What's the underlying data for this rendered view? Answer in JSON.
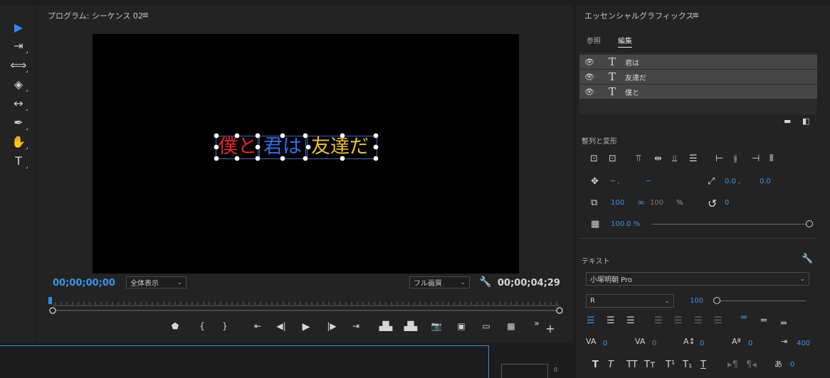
{
  "program": {
    "title": "プログラム: シーケンス 02",
    "menu_icon": "≡",
    "timecode_current": "00;00;00;00",
    "timecode_total": "00;00;04;29",
    "zoom": "全体表示",
    "quality": "フル画質"
  },
  "captions": [
    "僕と",
    "君は",
    "友達だ"
  ],
  "caption_colors": [
    "#e0262a",
    "#2f6fe6",
    "#e8c13a"
  ],
  "tools": [
    "selection-tool",
    "track-select-tool",
    "ripple-edit-tool",
    "razor-tool",
    "slip-tool",
    "pen-tool",
    "hand-tool",
    "type-tool"
  ],
  "eg": {
    "title": "エッセンシャルグラフィックス",
    "menu_icon": "≡",
    "tabs": [
      "参照",
      "編集"
    ],
    "layers": [
      "君は",
      "友達だ",
      "僕と"
    ],
    "align_section": "整列と変形",
    "position": [
      "─ ,",
      "─"
    ],
    "anchor": [
      "0.0 ,",
      "0.0"
    ],
    "scale": "100",
    "scale_linked": "100",
    "percent": "%",
    "rotation": "0",
    "opacity": "100.0 %",
    "text_section": "テキスト",
    "font": "小塚明朝 Pro",
    "style": "R",
    "font_size": "100",
    "tracking": "0",
    "kerning": "0",
    "leading": "0",
    "baseline": "0",
    "tsume": "0",
    "tab_width": "400",
    "last_value": "0"
  },
  "audio_meter_value": "0"
}
